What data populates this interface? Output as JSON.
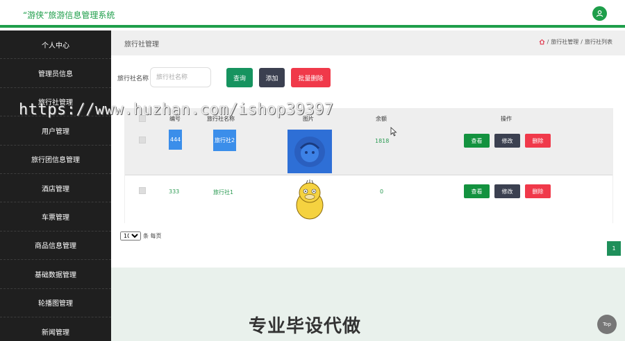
{
  "header": {
    "title": "“游侠”旅游信息管理系统",
    "user_icon": "user-icon"
  },
  "sidebar": {
    "items": [
      {
        "label": "个人中心"
      },
      {
        "label": "管理员信息"
      },
      {
        "label": "旅行社管理"
      },
      {
        "label": "用户管理"
      },
      {
        "label": "旅行团信息管理"
      },
      {
        "label": "酒店管理"
      },
      {
        "label": "车票管理"
      },
      {
        "label": "商品信息管理"
      },
      {
        "label": "基础数据管理"
      },
      {
        "label": "轮播图管理"
      },
      {
        "label": "新闻管理"
      }
    ]
  },
  "breadcrumb": {
    "page_title": "旅行社管理",
    "path_1": "旅行社管理",
    "path_2": "旅行社列表",
    "separator": "/"
  },
  "search": {
    "label": "旅行社名称",
    "placeholder": "旅行社名称",
    "query_button": "查询",
    "add_button": "添加",
    "batch_delete_button": "批量删除"
  },
  "table": {
    "headers": {
      "id": "编号",
      "name": "旅行社名称",
      "image": "图片",
      "balance": "余额",
      "actions": "操作"
    },
    "rows": [
      {
        "id": "444",
        "name": "旅行社2",
        "balance": "1818",
        "view": "查看",
        "edit": "修改",
        "delete": "删除"
      },
      {
        "id": "333",
        "name": "旅行社1",
        "balance": "0",
        "view": "查看",
        "edit": "修改",
        "delete": "删除"
      }
    ]
  },
  "pagination": {
    "page_size": "10",
    "per_page_text": "条 每页",
    "current_page": "1"
  },
  "overlay": {
    "watermark": "https://www.huzhan.com/ishop39397",
    "footer_ad": "专业毕设代做",
    "top_button": "Top"
  },
  "colors": {
    "brand_green": "#1e9e4a",
    "sidebar_bg": "#1f1f1f",
    "delete_red": "#f0394a",
    "dark_button": "#3b4050"
  }
}
